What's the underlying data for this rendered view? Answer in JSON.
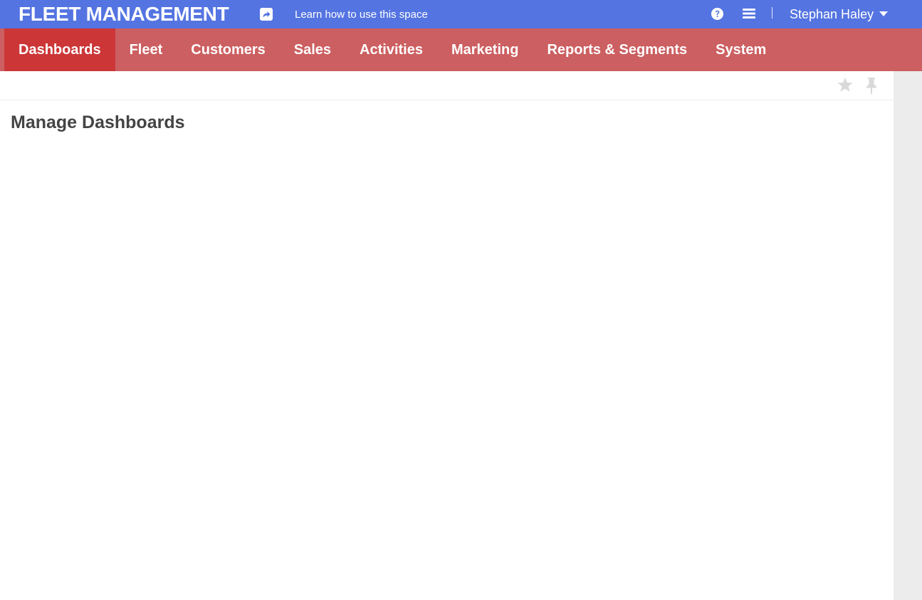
{
  "header": {
    "app_title": "FLEET MANAGEMENT",
    "learn_link": "Learn how to use this space",
    "user_name": "Stephan Haley",
    "icons": [
      "share-icon",
      "help-icon",
      "menu-icon",
      "caret-down-icon"
    ],
    "colors": {
      "background": "#5474e1",
      "text": "#ffffff"
    }
  },
  "nav": {
    "items": [
      {
        "label": "Dashboards",
        "active": true
      },
      {
        "label": "Fleet",
        "active": false
      },
      {
        "label": "Customers",
        "active": false
      },
      {
        "label": "Sales",
        "active": false
      },
      {
        "label": "Activities",
        "active": false
      },
      {
        "label": "Marketing",
        "active": false
      },
      {
        "label": "Reports & Segments",
        "active": false
      },
      {
        "label": "System",
        "active": false
      }
    ],
    "colors": {
      "background": "#cc5f61",
      "active_background": "#cc3637"
    }
  },
  "toolbar": {
    "icons": [
      "star-icon",
      "pin-icon"
    ]
  },
  "main": {
    "page_title": "Manage Dashboards"
  }
}
